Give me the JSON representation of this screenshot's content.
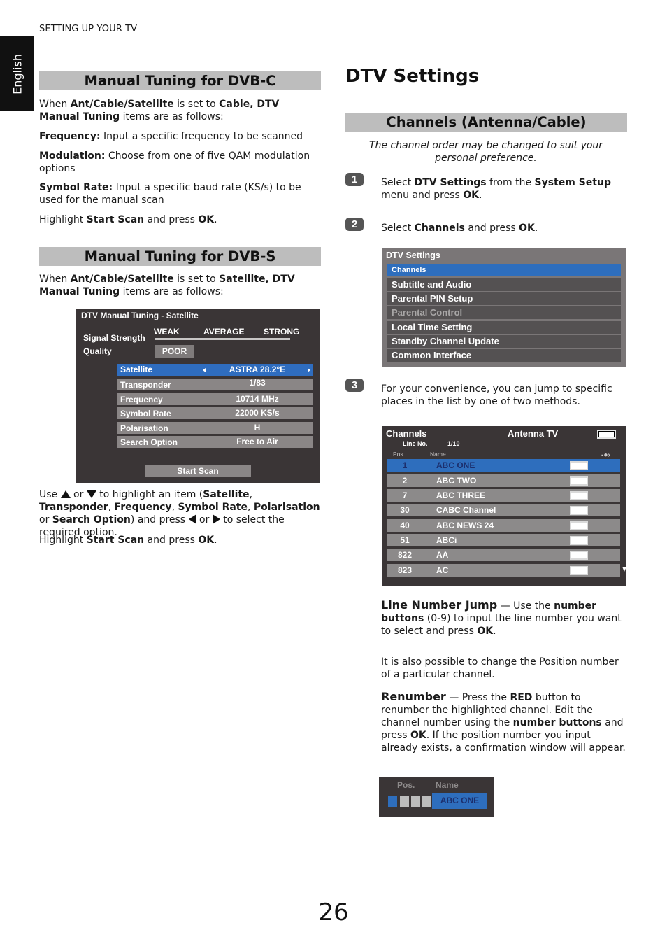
{
  "header": {
    "running_head": "SETTING UP YOUR TV",
    "language_tab": "English"
  },
  "dvbc": {
    "title": "Manual Tuning for DVB-C",
    "intro": {
      "t1": "When ",
      "b1": "Ant/Cable/Satellite",
      "t2": " is set to ",
      "b2": "Cable, DTV Manual Tuning",
      "t3": " items are as follows:"
    },
    "items": [
      {
        "label": "Frequency:",
        "text": " Input a specific frequency to be scanned"
      },
      {
        "label": "Modulation:",
        "text": " Choose from one of five QAM modulation options"
      },
      {
        "label": "Symbol Rate:",
        "text": " Input a specific baud rate (KS/s) to be used for the manual scan"
      }
    ],
    "highlight": {
      "t1": "Highlight ",
      "b1": "Start Scan",
      "t2": " and press ",
      "b2": "OK",
      "t3": "."
    }
  },
  "dvbs": {
    "title": "Manual Tuning for DVB-S",
    "intro": {
      "t1": "When ",
      "b1": "Ant/Cable/Satellite",
      "t2": " is set to ",
      "b2": "Satellite, DTV Manual Tuning",
      "t3": " items are as follows:"
    },
    "screen": {
      "title": "DTV Manual Tuning - Satellite",
      "signal_label": "Signal Strength",
      "quality_label": "Quality",
      "scale": [
        "WEAK",
        "AVERAGE",
        "STRONG"
      ],
      "quality_value": "POOR",
      "rows": [
        {
          "label": "Satellite",
          "value": "ASTRA 28.2°E"
        },
        {
          "label": "Transponder",
          "value": "1/83"
        },
        {
          "label": "Frequency",
          "value": "10714 MHz"
        },
        {
          "label": "Symbol Rate",
          "value": "22000 KS/s"
        },
        {
          "label": "Polarisation",
          "value": "H"
        },
        {
          "label": "Search Option",
          "value": "Free to Air"
        }
      ],
      "start_scan": "Start Scan"
    },
    "usage": {
      "t1": "Use ",
      "t2": " or ",
      "t3": " to highlight an item (",
      "b1": "Satellite",
      "c1": ", ",
      "b2": "Transponder",
      "c2": ", ",
      "b3": "Frequency",
      "c3": ", ",
      "b4": "Symbol Rate",
      "c4": ", ",
      "b5": "Polarisation",
      "c5": " or ",
      "b6": "Search Option",
      "c6": ")",
      "t4": " and press ",
      "t5": " or ",
      "t6": " to select the required option."
    },
    "highlight": {
      "t1": "Highlight ",
      "b1": "Start Scan",
      "t2": " and press ",
      "b2": "OK",
      "t3": "."
    }
  },
  "dtv": {
    "title": "DTV Settings",
    "section": "Channels (Antenna/Cable)",
    "note": "The channel order may be changed to suit your personal preference.",
    "steps": [
      {
        "num": "1",
        "t1": "Select ",
        "b1": "DTV Settings",
        "t2": " from the ",
        "b2": "System Setup",
        "t3": " menu and press ",
        "b3": "OK",
        "t4": "."
      },
      {
        "num": "2",
        "t1": "Select ",
        "b1": "Channels",
        "t2": " and press ",
        "b2": "OK",
        "t3": "."
      },
      {
        "num": "3",
        "text": "For your convenience, you can jump to specific places in the list by one of two methods."
      }
    ],
    "menu": {
      "title": "DTV Settings",
      "items": [
        "Channels",
        "Subtitle and Audio",
        "Parental PIN Setup",
        "Parental Control",
        "Local Time Setting",
        "Standby Channel Update",
        "Common Interface"
      ]
    },
    "channels": {
      "title": "Channels",
      "source": "Antenna TV",
      "line_label": "Line No.",
      "line_value": "1/10",
      "col_pos": "Pos.",
      "col_name": "Name",
      "rows": [
        {
          "pos": "1",
          "name": "ABC ONE"
        },
        {
          "pos": "2",
          "name": "ABC TWO"
        },
        {
          "pos": "7",
          "name": "ABC THREE"
        },
        {
          "pos": "30",
          "name": "CABC Channel"
        },
        {
          "pos": "40",
          "name": "ABC NEWS 24"
        },
        {
          "pos": "51",
          "name": "ABCi"
        },
        {
          "pos": "822",
          "name": "AA"
        },
        {
          "pos": "823",
          "name": "AC"
        }
      ]
    },
    "line_jump": {
      "heading": "Line Number Jump",
      "t1": " — Use the ",
      "b1": "number buttons",
      "t2": " (0-9) to input the line number you want to select and press ",
      "b2": "OK",
      "t3": "."
    },
    "position_note": "It is also possible to change the Position number of a particular channel.",
    "renumber": {
      "heading": "Renumber",
      "t1": " — Press the ",
      "b1": "RED",
      "t2": " button to renumber the highlighted channel. Edit the channel number using the ",
      "b2": "number buttons",
      "t3": " and press ",
      "b3": "OK",
      "t4": ". If the position number you input already exists, a confirmation window will appear."
    },
    "renumber_screen": {
      "col_pos": "Pos.",
      "col_name": "Name",
      "name": "ABC ONE"
    }
  },
  "page_number": "26",
  "colors": {
    "highlight_blue": "#2e6ebd",
    "section_gray": "#bdbdbd",
    "tv_background": "#3a3536"
  }
}
